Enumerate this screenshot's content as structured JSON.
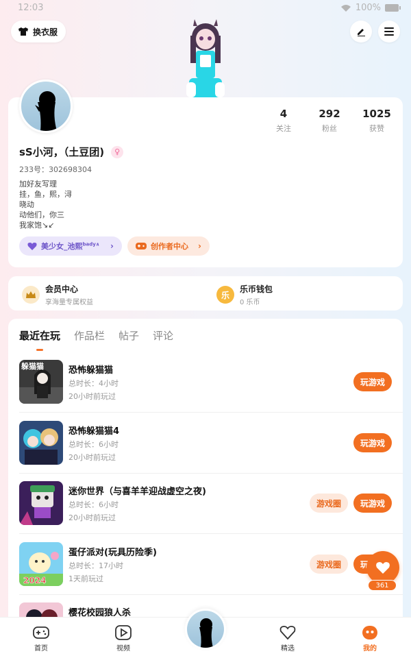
{
  "status_bar": {
    "time": "12:03",
    "battery": "100%"
  },
  "header": {
    "dress_label": "换衣服"
  },
  "profile": {
    "stats": [
      {
        "value": "4",
        "label": "关注"
      },
      {
        "value": "292",
        "label": "粉丝"
      },
      {
        "value": "1025",
        "label": "获赞"
      }
    ],
    "username": "sS小河，（土豆团)",
    "gender_symbol": "♀",
    "uid": "233号：302698304",
    "bio": [
      "加好友写理",
      "挂，鱼，熙，浔",
      "晓动",
      "动他们，你三",
      "我家饱↘↙"
    ],
    "tags": {
      "group": "美少女_池熙",
      "group_sup": "bady∧",
      "creator": "创作者中心"
    }
  },
  "wallet": {
    "member_title": "会员中心",
    "member_sub": "享海量专属权益",
    "coin_icon": "乐",
    "coin_title": "乐币钱包",
    "coin_sub": "0 乐币"
  },
  "tabs": [
    "最近在玩",
    "作品栏",
    "帖子",
    "评论"
  ],
  "games": [
    {
      "title": "恐怖躲猫猫",
      "duration": "总时长：4小时",
      "last_played": "20小时前玩过",
      "thumb_text": "躲猫猫",
      "play": "玩游戏",
      "circle": ""
    },
    {
      "title": "恐怖躲猫猫4",
      "duration": "总时长：6小时",
      "last_played": "20小时前玩过",
      "thumb_text": "",
      "play": "玩游戏",
      "circle": ""
    },
    {
      "title": "迷你世界（与喜羊羊迎战虚空之夜)",
      "duration": "总时长：6小时",
      "last_played": "20小时前玩过",
      "thumb_text": "",
      "play": "玩游戏",
      "circle": "游戏圈"
    },
    {
      "title": "蛋仔派对(玩具历险季)",
      "duration": "总时长：17小时",
      "last_played": "1天前玩过",
      "thumb_text": "2024",
      "play": "玩游戏",
      "circle": "游戏圈"
    },
    {
      "title": "樱花校园狼人杀",
      "duration": "",
      "last_played": "",
      "thumb_text": "",
      "play": "",
      "circle": ""
    }
  ],
  "floating": {
    "count": "361"
  },
  "nav": [
    {
      "label": "首页"
    },
    {
      "label": "视频"
    },
    {
      "label": "精选"
    },
    {
      "label": "我的"
    }
  ],
  "colors": {
    "accent": "#f26f21",
    "purple": "#6e56c9"
  }
}
